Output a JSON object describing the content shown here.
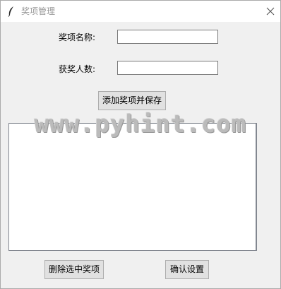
{
  "window": {
    "title": "奖项管理",
    "title_icon": "feather-icon",
    "close_icon": "close-icon"
  },
  "form": {
    "name_label": "奖项名称:",
    "name_value": "",
    "count_label": "获奖人数:",
    "count_value": ""
  },
  "buttons": {
    "add_save": "添加奖项并保存",
    "delete_selected": "删除选中奖项",
    "confirm": "确认设置"
  },
  "list": {
    "items": []
  },
  "watermark": "www.pyhint.com"
}
